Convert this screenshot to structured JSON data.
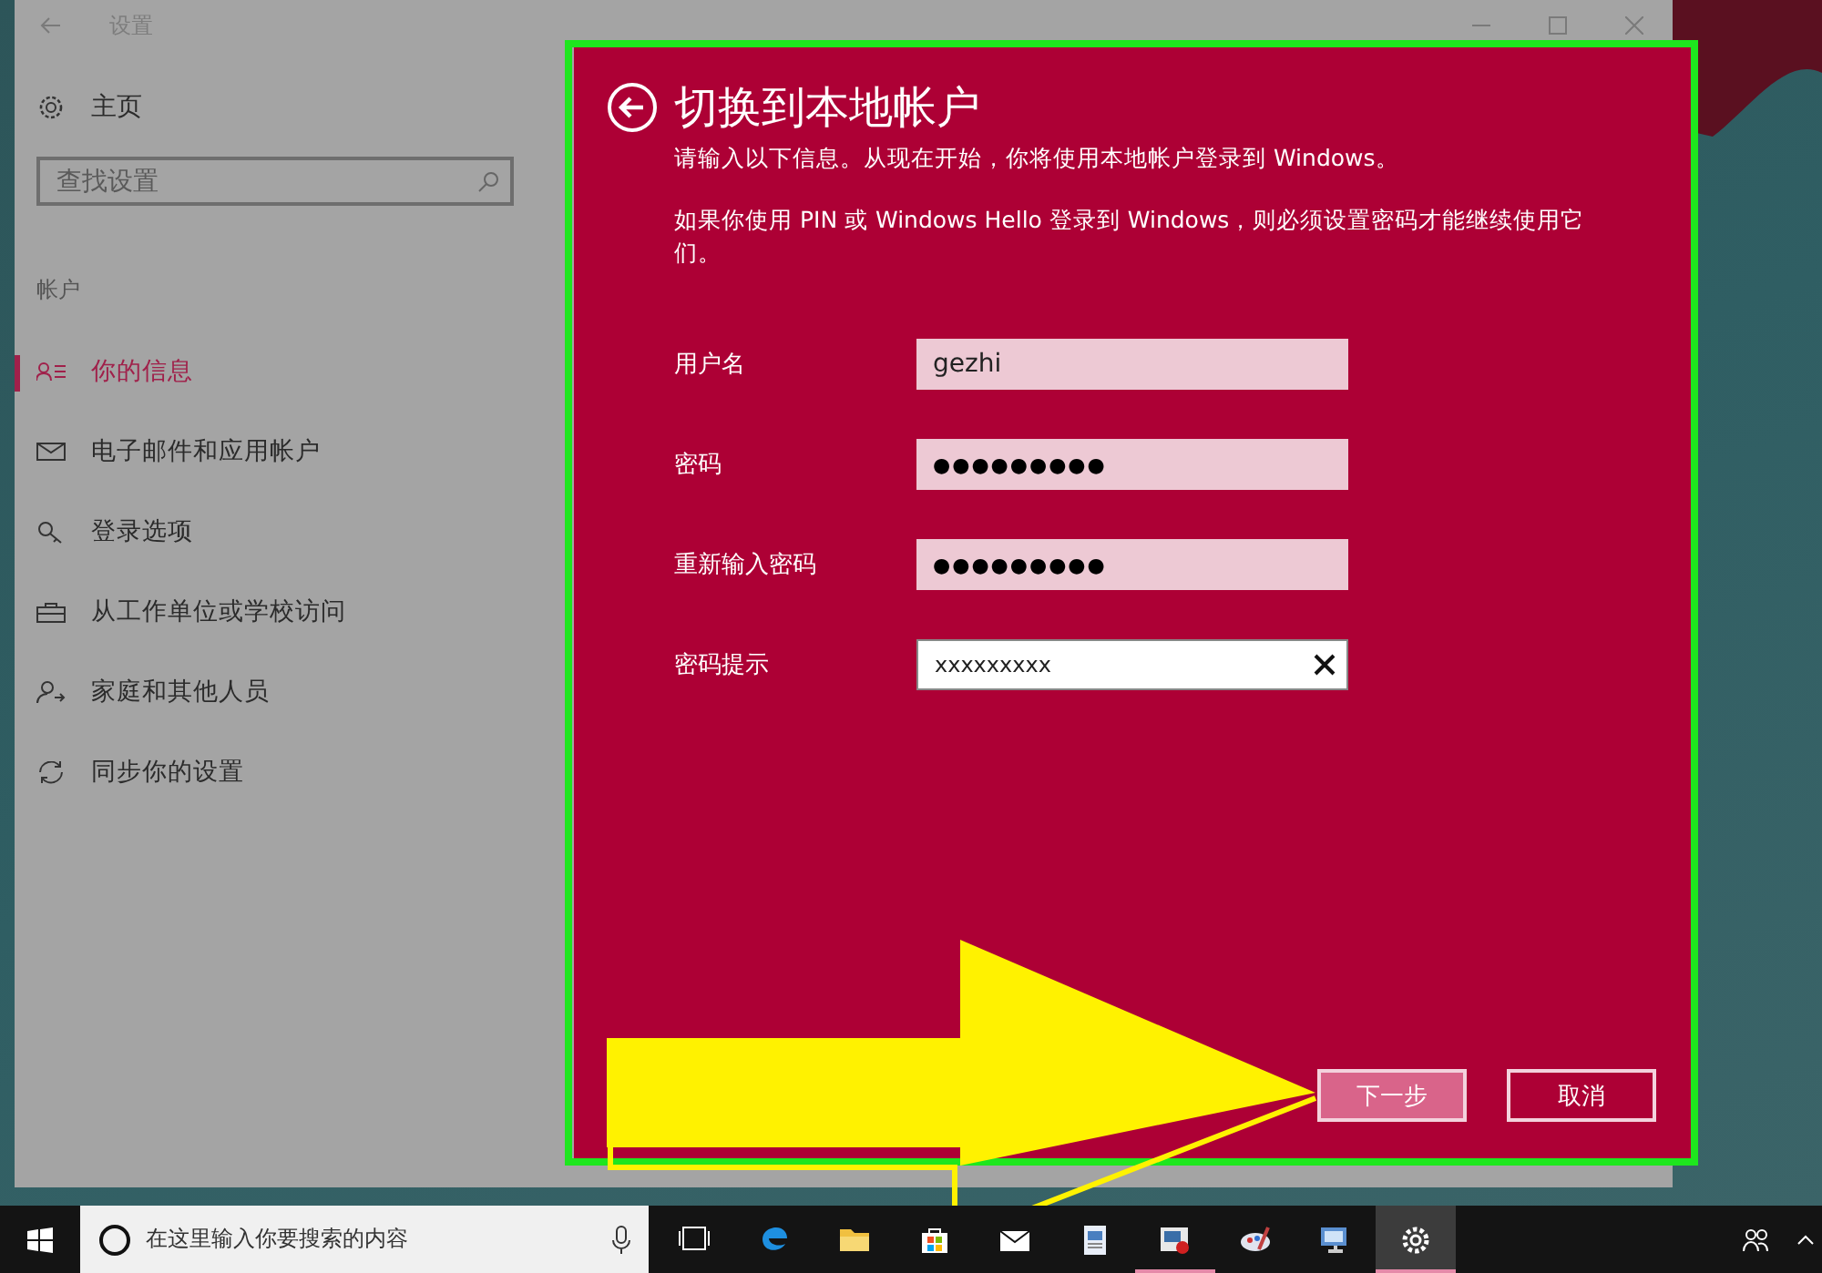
{
  "window": {
    "title": "设置",
    "home": "主页",
    "search": {
      "placeholder": "查找设置"
    },
    "section": "帐户",
    "nav": [
      {
        "label": "你的信息",
        "selected": true
      },
      {
        "label": "电子邮件和应用帐户",
        "selected": false
      },
      {
        "label": "登录选项",
        "selected": false
      },
      {
        "label": "从工作单位或学校访问",
        "selected": false
      },
      {
        "label": "家庭和其他人员",
        "selected": false
      },
      {
        "label": "同步你的设置",
        "selected": false
      }
    ]
  },
  "dialog": {
    "title": "切换到本地帐户",
    "intro": "请输入以下信息。从现在开始，你将使用本地帐户登录到 Windows。",
    "note": "如果你使用 PIN 或 Windows Hello 登录到 Windows，则必须设置密码才能继续使用它们。",
    "fields": [
      {
        "label": "用户名",
        "value": "gezhi",
        "kind": "text",
        "focused": false
      },
      {
        "label": "密码",
        "value": "●●●●●●●●●",
        "kind": "password",
        "focused": false
      },
      {
        "label": "重新输入密码",
        "value": "●●●●●●●●●",
        "kind": "password",
        "focused": false
      },
      {
        "label": "密码提示",
        "value": "xxxxxxxxx",
        "kind": "text",
        "focused": true
      }
    ],
    "buttons": [
      {
        "label": "下一步",
        "kind": "primary"
      },
      {
        "label": "取消",
        "kind": "secondary"
      }
    ]
  },
  "taskbar": {
    "search": {
      "placeholder": "在这里输入你要搜索的内容"
    },
    "apps": [
      {
        "kind": "task-view",
        "running": false,
        "selected": false
      },
      {
        "kind": "edge",
        "running": false,
        "selected": false
      },
      {
        "kind": "folder",
        "running": false,
        "selected": false
      },
      {
        "kind": "store",
        "running": false,
        "selected": false
      },
      {
        "kind": "mail",
        "running": false,
        "selected": false
      },
      {
        "kind": "document",
        "running": false,
        "selected": false
      },
      {
        "kind": "presentation",
        "running": true,
        "selected": false
      },
      {
        "kind": "paint",
        "running": false,
        "selected": false
      },
      {
        "kind": "remote",
        "running": false,
        "selected": false
      },
      {
        "kind": "settings",
        "running": true,
        "selected": true
      }
    ]
  }
}
